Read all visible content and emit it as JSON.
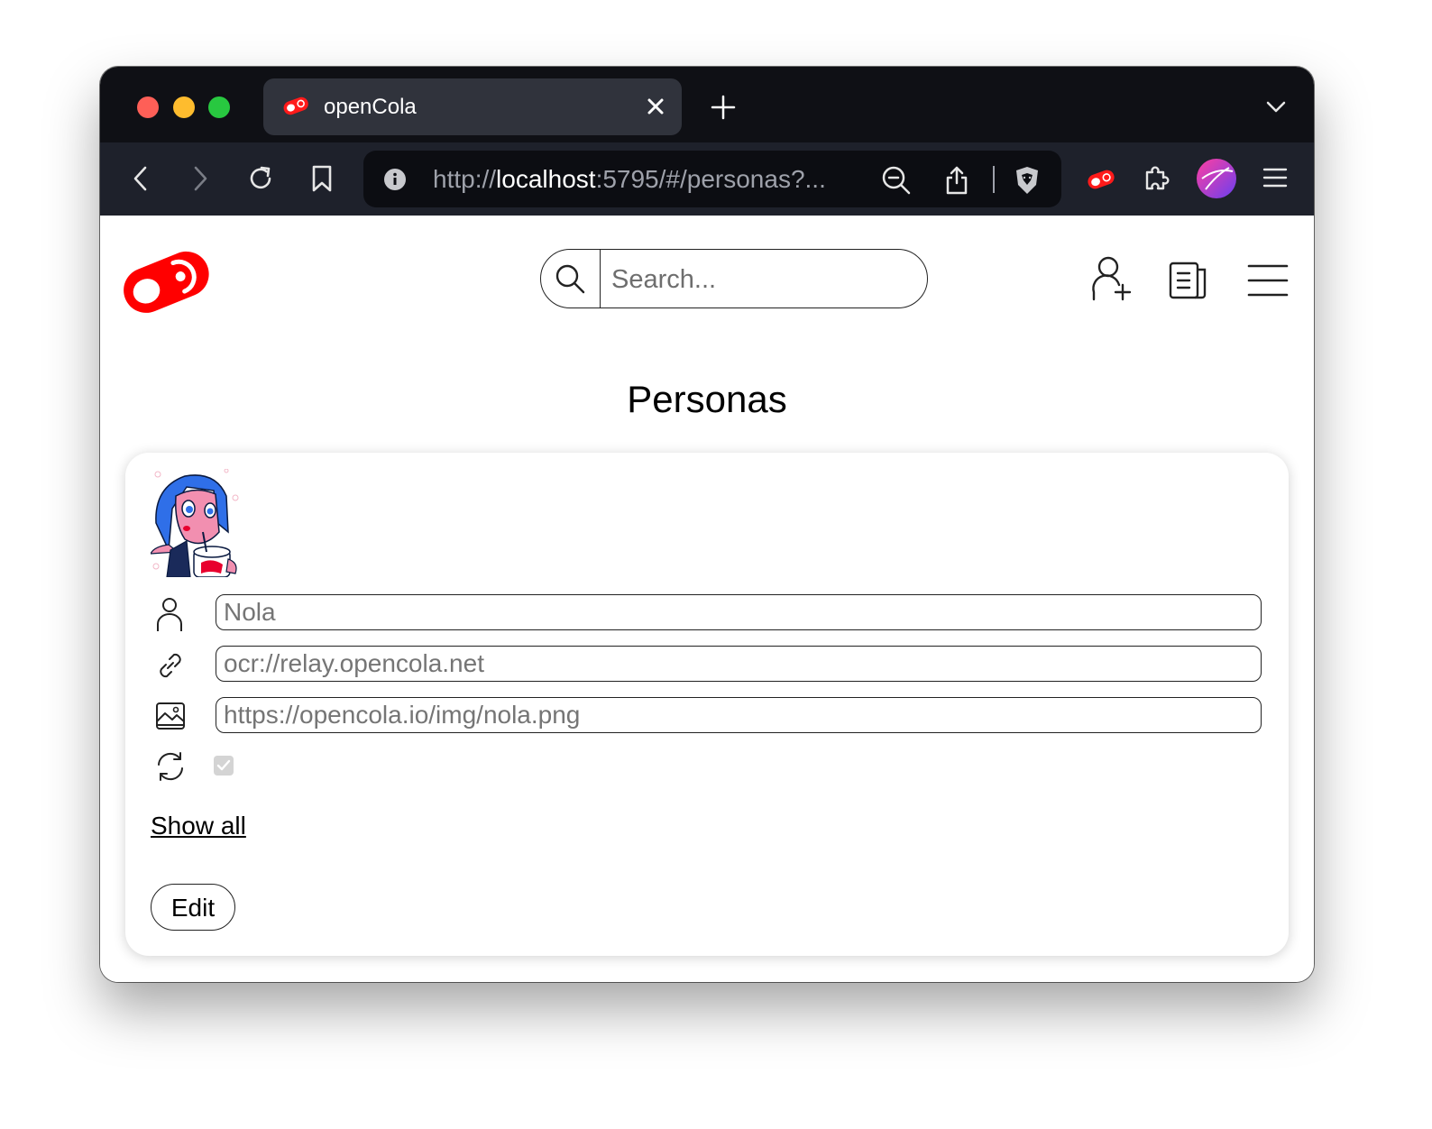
{
  "browser": {
    "tab": {
      "title": "openCola"
    },
    "url": {
      "scheme": "http://",
      "host": "localhost",
      "rest": ":5795/#/personas?..."
    }
  },
  "header": {
    "search": {
      "placeholder": "Search..."
    }
  },
  "page": {
    "title": "Personas"
  },
  "persona": {
    "name": "Nola",
    "address": "ocr://relay.opencola.net",
    "image_uri": "https://opencola.io/img/nola.png",
    "sync_enabled": true
  },
  "actions": {
    "show_all": "Show all",
    "edit": "Edit"
  },
  "colors": {
    "brand_red": "#ff0000",
    "tabstrip": "#0f1015",
    "toolbar": "#1e212b"
  }
}
